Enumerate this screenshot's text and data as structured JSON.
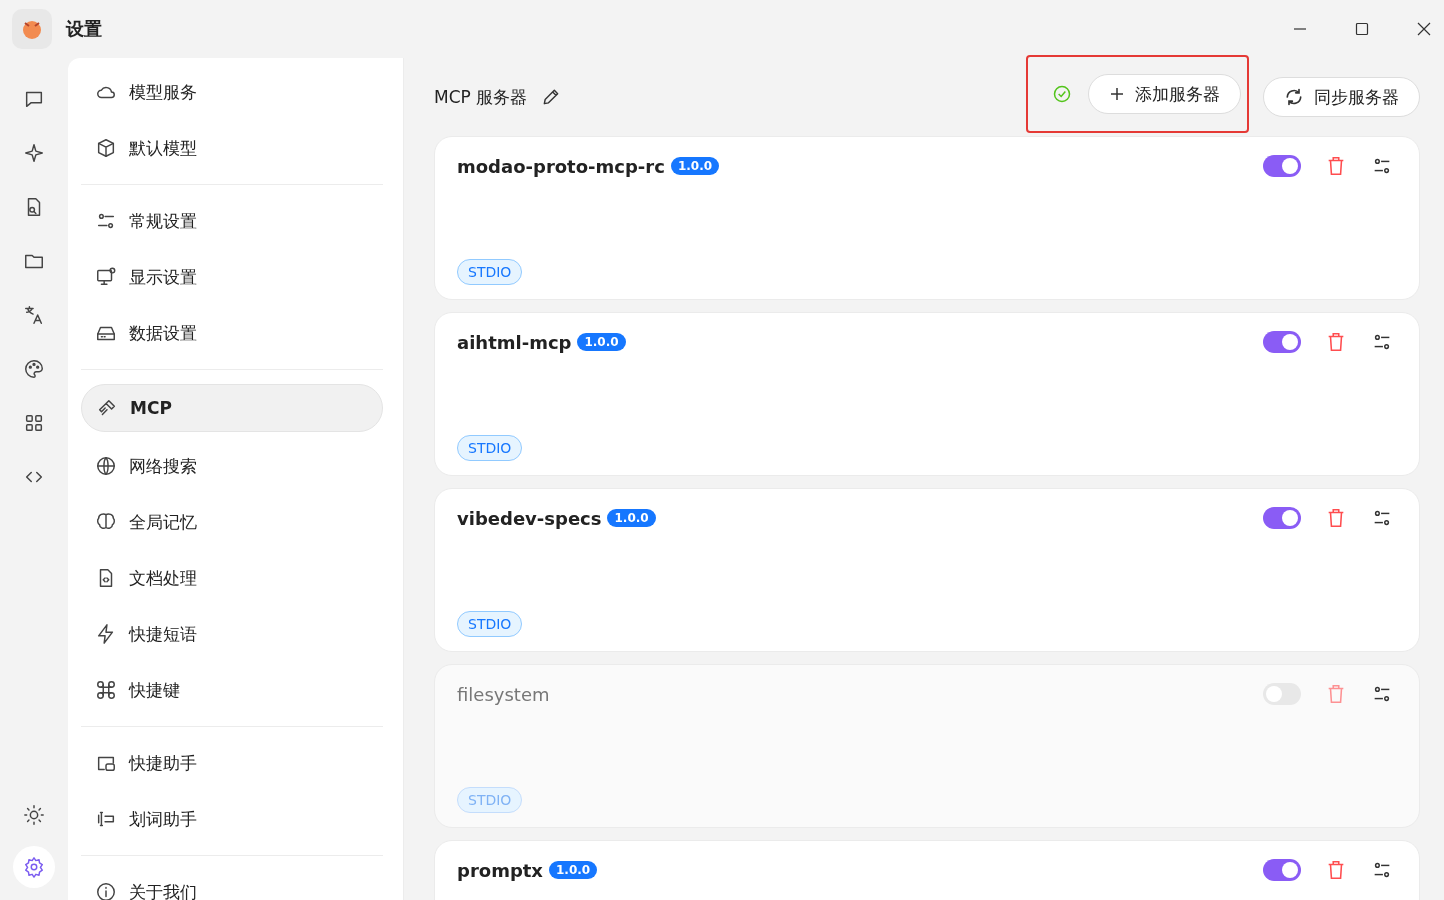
{
  "window": {
    "title": "设置"
  },
  "rail": [
    {
      "selected": false
    },
    {
      "selected": false
    },
    {
      "selected": false
    },
    {
      "selected": false
    },
    {
      "selected": false
    },
    {
      "selected": false
    },
    {
      "selected": false
    },
    {
      "selected": false
    }
  ],
  "rail_bottom": [
    {
      "selected": false
    },
    {
      "selected": true
    }
  ],
  "nav_groups": [
    {
      "items": [
        {
          "label": "模型服务",
          "selected": false
        },
        {
          "label": "默认模型",
          "selected": false
        }
      ]
    },
    {
      "items": [
        {
          "label": "常规设置",
          "selected": false
        },
        {
          "label": "显示设置",
          "selected": false
        },
        {
          "label": "数据设置",
          "selected": false
        }
      ]
    },
    {
      "items": [
        {
          "label": "MCP",
          "selected": true
        },
        {
          "label": "网络搜索",
          "selected": false
        },
        {
          "label": "全局记忆",
          "selected": false
        },
        {
          "label": "文档处理",
          "selected": false
        },
        {
          "label": "快捷短语",
          "selected": false
        },
        {
          "label": "快捷键",
          "selected": false
        }
      ]
    },
    {
      "items": [
        {
          "label": "快捷助手",
          "selected": false
        },
        {
          "label": "划词助手",
          "selected": false
        }
      ]
    },
    {
      "items": [
        {
          "label": "关于我们",
          "selected": false
        }
      ]
    }
  ],
  "header": {
    "title": "MCP 服务器",
    "add_button": "添加服务器",
    "sync_button": "同步服务器"
  },
  "servers": [
    {
      "name": "modao-proto-mcp-rc",
      "version": "1.0.0",
      "transport": "STDIO",
      "enabled": true
    },
    {
      "name": "aihtml-mcp",
      "version": "1.0.0",
      "transport": "STDIO",
      "enabled": true
    },
    {
      "name": "vibedev-specs",
      "version": "1.0.0",
      "transport": "STDIO",
      "enabled": true
    },
    {
      "name": "filesystem",
      "transport": "STDIO",
      "enabled": false
    },
    {
      "name": "promptx",
      "version": "1.0.0",
      "enabled": true
    }
  ]
}
